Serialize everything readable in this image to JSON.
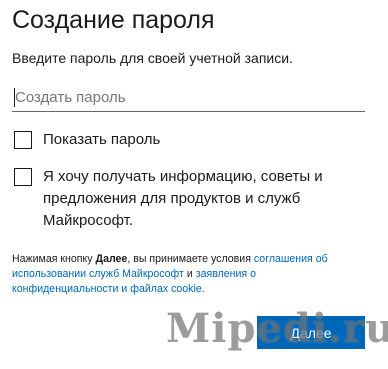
{
  "header": {
    "title": "Создание пароля",
    "subtitle": "Введите пароль для своей учетной записи."
  },
  "password": {
    "placeholder": "Создать пароль",
    "value": ""
  },
  "checkboxes": [
    {
      "label": "Показать пароль",
      "checked": false
    },
    {
      "label": "Я хочу получать информацию, советы и предложения для продуктов и служб Майкрософт.",
      "checked": false
    }
  ],
  "legal": {
    "prefix": "Нажимая кнопку ",
    "button_ref": "Далее",
    "middle": ", вы принимаете условия ",
    "link1": "соглашения об использовании служб Майкрософт",
    "conj": " и ",
    "link2": "заявления о конфиденциальности и файлах cookie",
    "suffix": "."
  },
  "next_button": {
    "label": "Далее"
  },
  "watermark": "Mipedi.ru",
  "colors": {
    "accent": "#0067b8",
    "text": "#1b1b1b",
    "placeholder": "#767676"
  }
}
